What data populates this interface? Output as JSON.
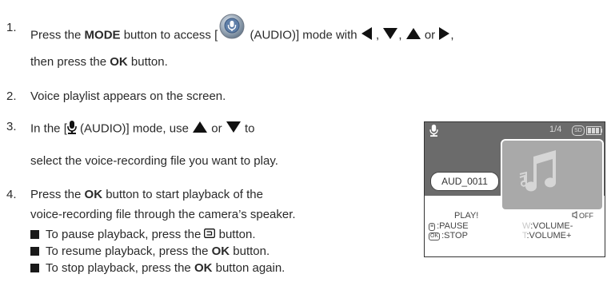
{
  "steps": [
    {
      "number": "1.",
      "line1_before": "Press the ",
      "line1_bold": "MODE",
      "line1_mid": " button to access [",
      "line1_after_icon": " (AUDIO)] mode with ",
      "line1_sep1": " , ",
      "line1_sep2": ", ",
      "line1_sep3": " or ",
      "line1_end": ",",
      "line2_before": "then press the ",
      "line2_bold": "OK",
      "line2_after": " button."
    },
    {
      "number": "2.",
      "text": "Voice playlist appears on the screen."
    },
    {
      "number": "3.",
      "line1_before": "In the [",
      "line1_after_icon": " (AUDIO)] mode, use ",
      "line1_or": " or ",
      "line1_to": " to",
      "line2": "select the voice-recording file you want to play."
    },
    {
      "number": "4.",
      "line1_before": "Press the ",
      "line1_bold": "OK",
      "line1_after": " button to start playback of the",
      "line2": "voice-recording file through the camera’s speaker."
    }
  ],
  "bullets": [
    {
      "before": "To pause playback, press the ",
      "bold": "",
      "after": " button."
    },
    {
      "before": "To resume playback, press the ",
      "bold": "OK",
      "after": " button."
    },
    {
      "before": "To stop playback, press the ",
      "bold": "OK",
      "after": " button again."
    }
  ],
  "screen": {
    "counter": "1/4",
    "sd": "SD",
    "filename": "AUD_0011",
    "status": "PLAY!",
    "off": "OFF",
    "pause": ":PAUSE",
    "stop": ":STOP",
    "volume_minus": ":VOLUME-",
    "volume_plus": ":VOLUME+",
    "key_w": "W",
    "key_t": "T",
    "key_ok": "OK"
  },
  "icons": {
    "audio_mode": "audio-mode-dial-icon",
    "microphone": "microphone-icon",
    "left": "left-arrow-icon",
    "down": "down-arrow-icon",
    "up": "up-arrow-icon",
    "right": "right-arrow-icon",
    "pause_button": "pause-button-icon",
    "music_note": "music-note-icon",
    "speaker": "speaker-icon"
  }
}
